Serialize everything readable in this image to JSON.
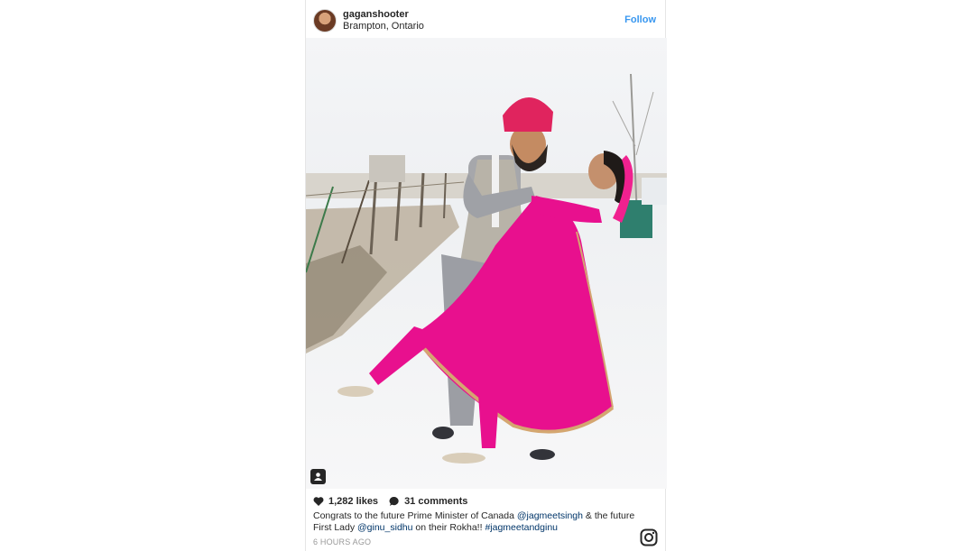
{
  "post": {
    "username": "gaganshooter",
    "location": "Brampton, Ontario",
    "follow_label": "Follow",
    "likes": "1,282 likes",
    "comments": "31 comments",
    "caption": {
      "part1": "Congrats to the future Prime Minister of Canada ",
      "mention1": "@jagmeetsingh",
      "part2": " & the future First Lady ",
      "mention2": "@ginu_sidhu",
      "part3": " on their Rokha!! ",
      "hashtag": "#jagmeetandginu"
    },
    "timestamp": "6 HOURS AGO"
  },
  "icons": {
    "avatar": "profile-avatar",
    "heart": "heart-icon",
    "comment": "comment-bubble-icon",
    "tag": "user-tag-icon",
    "brand": "instagram-logo-icon"
  },
  "colors": {
    "follow_blue": "#3897f0",
    "mention_blue": "#003569",
    "text": "#262626",
    "muted": "#999999"
  }
}
